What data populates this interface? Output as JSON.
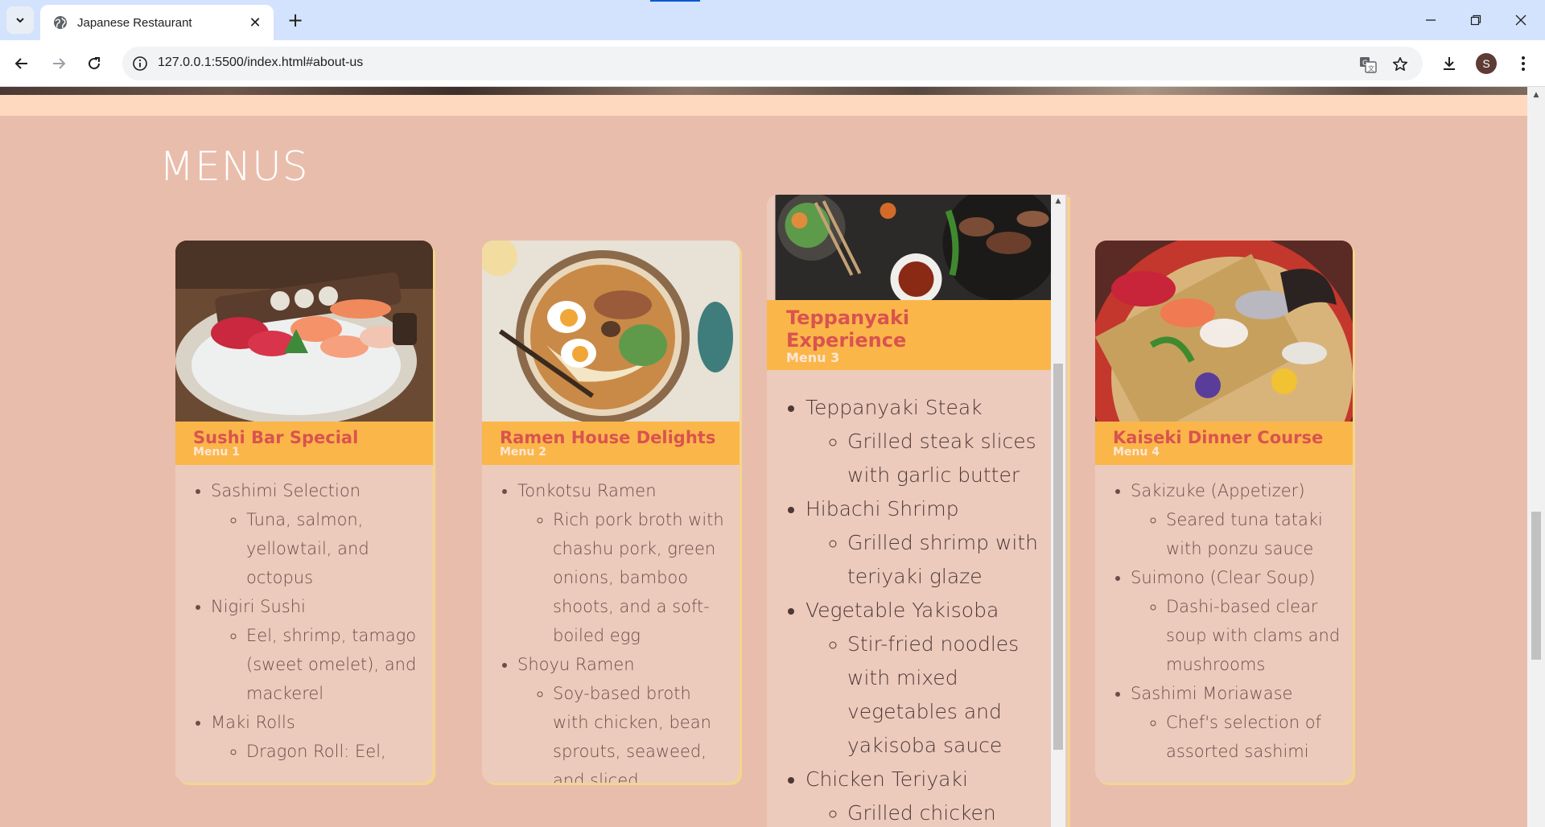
{
  "browser": {
    "tab_title": "Japanese Restaurant",
    "url": "127.0.0.1:5500/index.html#about-us",
    "profile_initial": "S"
  },
  "page": {
    "section_title": "MENUS",
    "menus": [
      {
        "name": "Sushi Bar Special",
        "subtitle": "Menu 1",
        "items": [
          {
            "label": "Sashimi Selection",
            "desc": "Tuna, salmon, yellowtail, and octopus"
          },
          {
            "label": "Nigiri Sushi",
            "desc": "Eel, shrimp, tamago (sweet omelet), and mackerel"
          },
          {
            "label": "Maki Rolls",
            "desc": "Dragon Roll: Eel,"
          }
        ]
      },
      {
        "name": "Ramen House Delights",
        "subtitle": "Menu 2",
        "items": [
          {
            "label": "Tonkotsu Ramen",
            "desc": "Rich pork broth with chashu pork, green onions, bamboo shoots, and a soft-boiled egg"
          },
          {
            "label": "Shoyu Ramen",
            "desc": "Soy-based broth with chicken, bean sprouts, seaweed, and sliced"
          }
        ]
      },
      {
        "name": "Teppanyaki Experience",
        "subtitle": "Menu 3",
        "items": [
          {
            "label": "Teppanyaki Steak",
            "desc": "Grilled steak slices with garlic butter"
          },
          {
            "label": "Hibachi Shrimp",
            "desc": "Grilled shrimp with teriyaki glaze"
          },
          {
            "label": "Vegetable Yakisoba",
            "desc": "Stir-fried noodles with mixed vegetables and yakisoba sauce"
          },
          {
            "label": "Chicken Teriyaki",
            "desc": "Grilled chicken with teriyaki"
          }
        ]
      },
      {
        "name": "Kaiseki Dinner Course",
        "subtitle": "Menu 4",
        "items": [
          {
            "label": "Sakizuke (Appetizer)",
            "desc": "Seared tuna tataki with ponzu sauce"
          },
          {
            "label": "Suimono (Clear Soup)",
            "desc": "Dashi-based clear soup with clams and mushrooms"
          },
          {
            "label": "Sashimi Moriawase",
            "desc": "Chef's selection of assorted sashimi"
          }
        ]
      }
    ]
  },
  "colors": {
    "page_bg": "#e9bdab",
    "band": "#fed9bf",
    "card_head": "#fbb64a",
    "card_title": "#d9534f",
    "card_body": "#eccbbd"
  },
  "icons": [
    "tab-search-icon",
    "globe-icon",
    "close-icon",
    "new-tab-icon",
    "minimize-icon",
    "restore-icon",
    "window-close-icon",
    "back-icon",
    "forward-icon",
    "reload-icon",
    "site-info-icon",
    "translate-icon",
    "bookmark-star-icon",
    "download-icon",
    "kebab-menu-icon"
  ]
}
